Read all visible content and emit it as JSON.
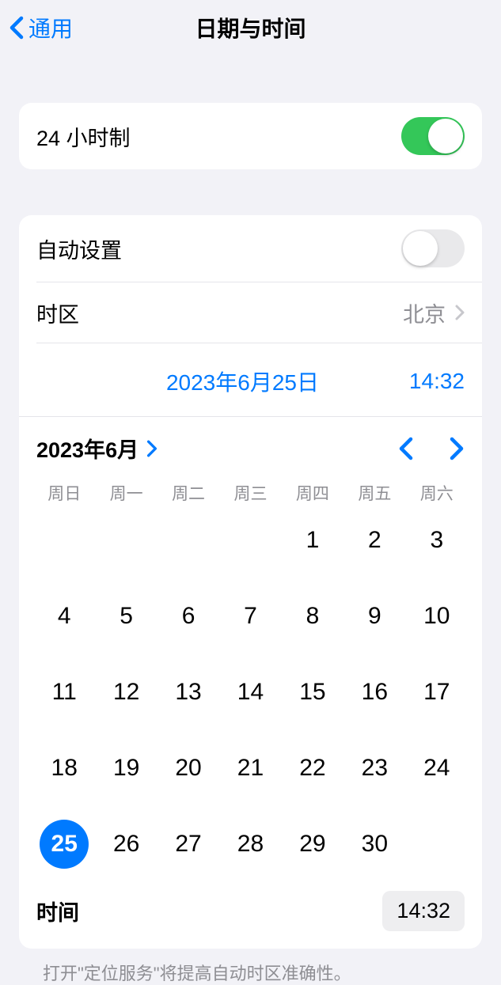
{
  "header": {
    "back_label": "通用",
    "title": "日期与时间"
  },
  "section1": {
    "twenty_four_hour_label": "24 小时制",
    "twenty_four_hour_on": true
  },
  "section2": {
    "auto_set_label": "自动设置",
    "auto_set_on": false,
    "timezone_label": "时区",
    "timezone_value": "北京",
    "date_display": "2023年6月25日",
    "time_display": "14:32"
  },
  "calendar": {
    "month_year": "2023年6月",
    "weekdays": [
      "周日",
      "周一",
      "周二",
      "周三",
      "周四",
      "周五",
      "周六"
    ],
    "leading_blanks": 4,
    "days": [
      1,
      2,
      3,
      4,
      5,
      6,
      7,
      8,
      9,
      10,
      11,
      12,
      13,
      14,
      15,
      16,
      17,
      18,
      19,
      20,
      21,
      22,
      23,
      24,
      25,
      26,
      27,
      28,
      29,
      30
    ],
    "selected_day": 25
  },
  "time_row": {
    "label": "时间",
    "value": "14:32"
  },
  "footer_note": "打开\"定位服务\"将提高自动时区准确性。"
}
